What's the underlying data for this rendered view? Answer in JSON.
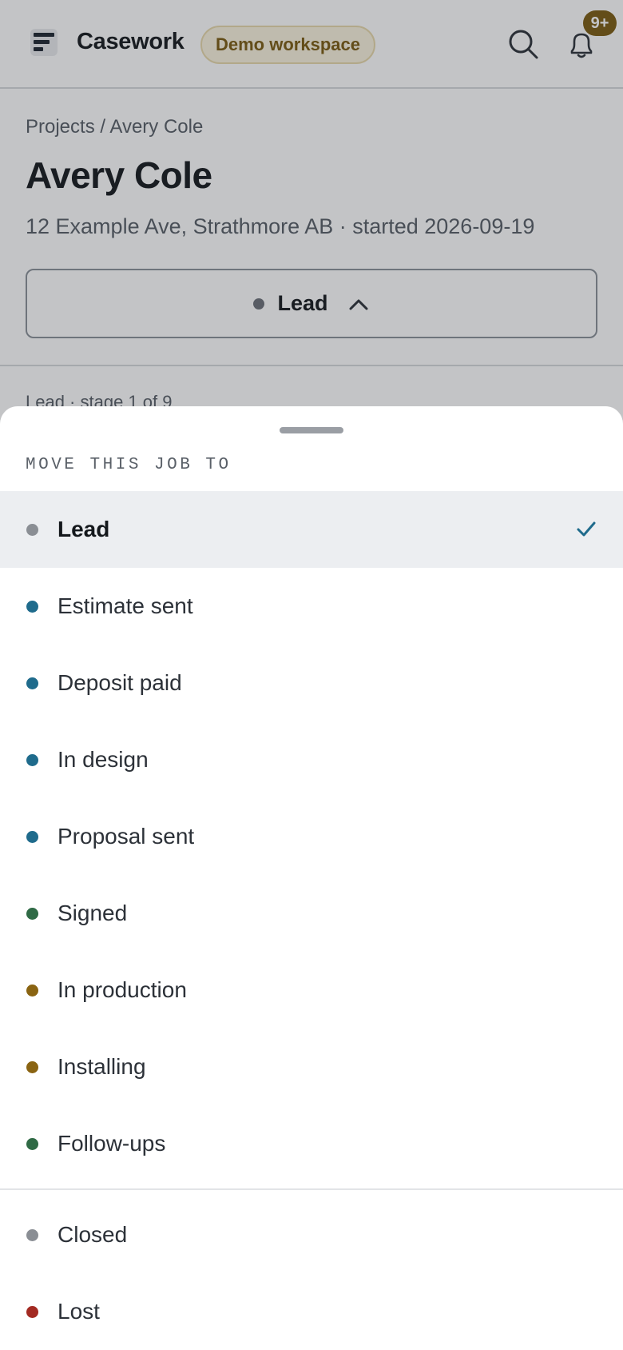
{
  "header": {
    "brand": "Casework",
    "workspace_badge": "Demo workspace",
    "notification_count": "9+"
  },
  "breadcrumb": "Projects / Avery Cole",
  "title": "Avery Cole",
  "subtitle": "12 Example Ave, Strathmore AB · started 2026-09-19",
  "stage_select": {
    "label": "Lead",
    "dot_color": "#6b7078"
  },
  "stage_progress": "Lead · stage 1 of 9",
  "sheet": {
    "heading": "MOVE THIS JOB TO",
    "selected": "Lead",
    "options": [
      {
        "label": "Lead",
        "color": "#8a8e94"
      },
      {
        "label": "Estimate sent",
        "color": "#1f6b8c"
      },
      {
        "label": "Deposit paid",
        "color": "#1f6b8c"
      },
      {
        "label": "In design",
        "color": "#1f6b8c"
      },
      {
        "label": "Proposal sent",
        "color": "#1f6b8c"
      },
      {
        "label": "Signed",
        "color": "#2f6a45"
      },
      {
        "label": "In production",
        "color": "#8a6412"
      },
      {
        "label": "Installing",
        "color": "#8a6412"
      },
      {
        "label": "Follow-ups",
        "color": "#2f6a45"
      },
      {
        "label": "Closed",
        "color": "#8a8e94"
      },
      {
        "label": "Lost",
        "color": "#a32a22"
      }
    ]
  }
}
